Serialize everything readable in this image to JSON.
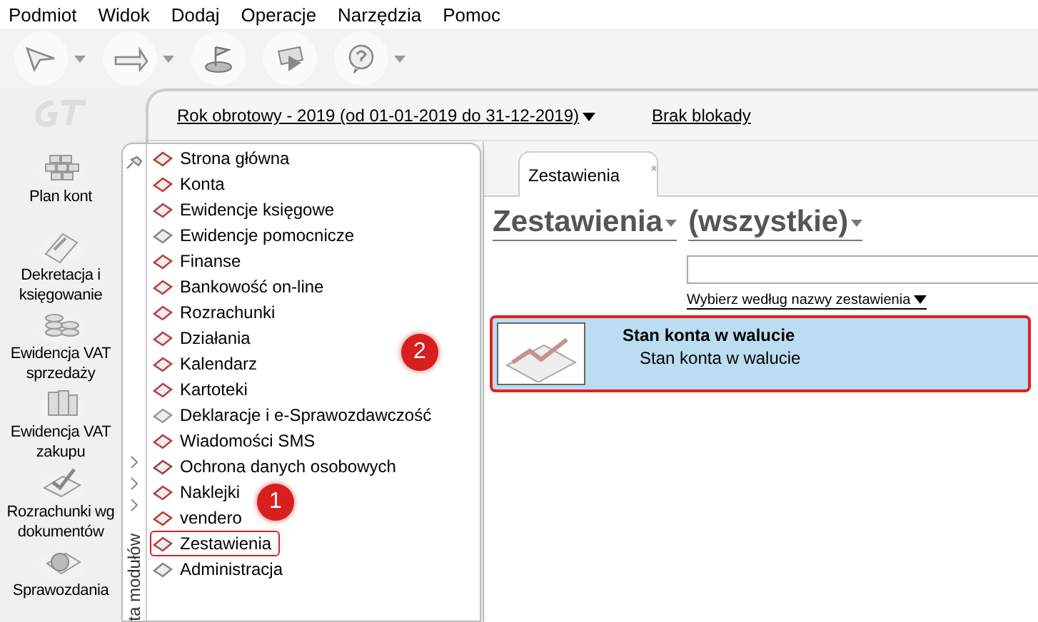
{
  "menu": [
    "Podmiot",
    "Widok",
    "Dodaj",
    "Operacje",
    "Narzędzia",
    "Pomoc"
  ],
  "toolbar": [
    {
      "has_dropdown": true
    },
    {
      "has_dropdown": true
    },
    {
      "has_dropdown": false
    },
    {
      "has_dropdown": false
    },
    {
      "has_dropdown": true
    }
  ],
  "header": {
    "period_link": "Rok obrotowy - 2019  (od 01-01-2019 do 31-12-2019)",
    "lock_link": "Brak blokady"
  },
  "sidebar": {
    "items": [
      {
        "label": "Plan kont"
      },
      {
        "label": "Dekretacja i księgowanie"
      },
      {
        "label": "Ewidencja VAT sprzedaży"
      },
      {
        "label": "Ewidencja VAT zakupu"
      },
      {
        "label": "Rozrachunki wg dokumentów"
      },
      {
        "label": "Sprawozdania"
      }
    ]
  },
  "modules": {
    "title": "ta modułów",
    "items": [
      {
        "label": "Strona główna",
        "selected": false
      },
      {
        "label": "Konta",
        "selected": false
      },
      {
        "label": "Ewidencje księgowe",
        "selected": false
      },
      {
        "label": "Ewidencje pomocnicze",
        "selected": false
      },
      {
        "label": "Finanse",
        "selected": false
      },
      {
        "label": "Bankowość on-line",
        "selected": false
      },
      {
        "label": "Rozrachunki",
        "selected": false
      },
      {
        "label": "Działania",
        "selected": false
      },
      {
        "label": "Kalendarz",
        "selected": false
      },
      {
        "label": "Kartoteki",
        "selected": false
      },
      {
        "label": "Deklaracje i e-Sprawozdawczość",
        "selected": false
      },
      {
        "label": "Wiadomości SMS",
        "selected": false
      },
      {
        "label": "Ochrona danych osobowych",
        "selected": false
      },
      {
        "label": "Naklejki",
        "selected": false
      },
      {
        "label": "vendero",
        "selected": false
      },
      {
        "label": "Zestawienia",
        "selected": true
      },
      {
        "label": "Administracja",
        "selected": false
      }
    ]
  },
  "tabs": [
    {
      "label": "Zestawienia",
      "selected": true
    }
  ],
  "content": {
    "heading": "Zestawienia",
    "filter": "(wszystkie)",
    "sort_link": "Wybierz według nazwy zestawienia"
  },
  "reports": [
    {
      "title": "Stan konta w walucie",
      "description": "Stan konta w walucie",
      "selected": true
    }
  ],
  "callouts": [
    {
      "number": "1"
    },
    {
      "number": "2"
    }
  ]
}
